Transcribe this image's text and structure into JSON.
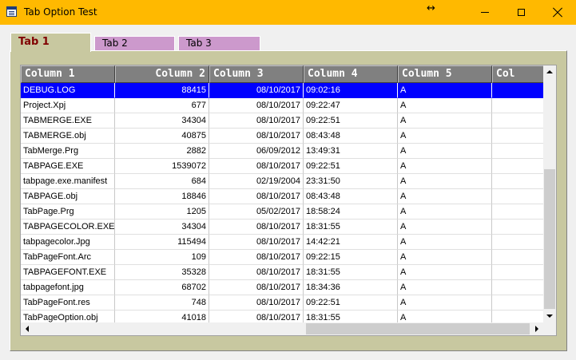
{
  "window": {
    "title": "Tab Option Test",
    "resize_glyph": "↔"
  },
  "tabs": [
    {
      "label": "Tab 1"
    },
    {
      "label": "Tab 2"
    },
    {
      "label": "Tab 3"
    }
  ],
  "grid": {
    "columns": [
      "Column 1",
      "Column 2",
      "Column 3",
      "Column 4",
      "Column 5",
      "Col"
    ],
    "rows": [
      [
        "DEBUG.LOG",
        "88415",
        "08/10/2017",
        "09:02:16",
        "A"
      ],
      [
        "Project.Xpj",
        "677",
        "08/10/2017",
        "09:22:47",
        "A"
      ],
      [
        "TABMERGE.EXE",
        "34304",
        "08/10/2017",
        "09:22:51",
        "A"
      ],
      [
        "TABMERGE.obj",
        "40875",
        "08/10/2017",
        "08:43:48",
        "A"
      ],
      [
        "TabMerge.Prg",
        "2882",
        "06/09/2012",
        "13:49:31",
        "A"
      ],
      [
        "TABPAGE.EXE",
        "1539072",
        "08/10/2017",
        "09:22:51",
        "A"
      ],
      [
        "tabpage.exe.manifest",
        "684",
        "02/19/2004",
        "23:31:50",
        "A"
      ],
      [
        "TABPAGE.obj",
        "18846",
        "08/10/2017",
        "08:43:48",
        "A"
      ],
      [
        "TabPage.Prg",
        "1205",
        "05/02/2017",
        "18:58:24",
        "A"
      ],
      [
        "TABPAGECOLOR.EXE",
        "34304",
        "08/10/2017",
        "18:31:55",
        "A"
      ],
      [
        "tabpagecolor.Jpg",
        "115494",
        "08/10/2017",
        "14:42:21",
        "A"
      ],
      [
        "TabPageFont.Arc",
        "109",
        "08/10/2017",
        "09:22:15",
        "A"
      ],
      [
        "TABPAGEFONT.EXE",
        "35328",
        "08/10/2017",
        "18:31:55",
        "A"
      ],
      [
        "tabpagefont.jpg",
        "68702",
        "08/10/2017",
        "18:34:36",
        "A"
      ],
      [
        "TabPageFont.res",
        "748",
        "08/10/2017",
        "09:22:51",
        "A"
      ],
      [
        "TabPageOption.obj",
        "41018",
        "08/10/2017",
        "18:31:55",
        "A"
      ]
    ],
    "selected_row": 0
  },
  "colors": {
    "titlebar": "#ffb900",
    "page": "#c8c8a0",
    "inactive_tab": "#cc99cc",
    "active_tab_text": "#800000",
    "header_bg": "#808080",
    "selection": "#0000ff"
  }
}
